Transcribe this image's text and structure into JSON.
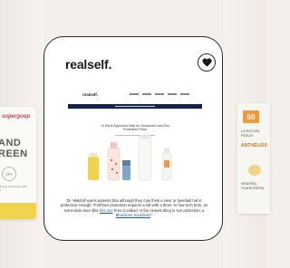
{
  "left_product": {
    "brand": "supergoop",
    "headline_line1": "AND",
    "headline_line2": "REEN",
    "spf_badge": "SPF",
    "fine_print": "Mineral Sunscreen SPF 30"
  },
  "right_product": {
    "spf": "50",
    "brand": "LA ROCHE-POSAY",
    "name": "ANTHELIOS",
    "detail": "MINERAL SUNSCREEN"
  },
  "card": {
    "logo_text": "realself",
    "logo_dot": ".",
    "article": {
      "mini_logo": "realself.",
      "title": "13 Derm Approved Hats for Sunscreen and Sun Protection Picks"
    },
    "caption": {
      "before_link1": "Dr. Waldorf warns patients that although they may think a visor or baseball hat is protection enough, “Full-face protection requires a hat with a three- to four-inch brim, an extra-wide visor (like ",
      "link1": "this one",
      "between": " from Coolibar) or the newest thing in sun protection, a ",
      "link2": "Bluestone Sunshield",
      "after": ".”"
    }
  },
  "colors": {
    "card_border": "#2b2b2b",
    "link": "#1d57b7",
    "banner": "#13224f",
    "background": "#f3efec"
  },
  "icons": {
    "favorite": "heart-icon"
  }
}
